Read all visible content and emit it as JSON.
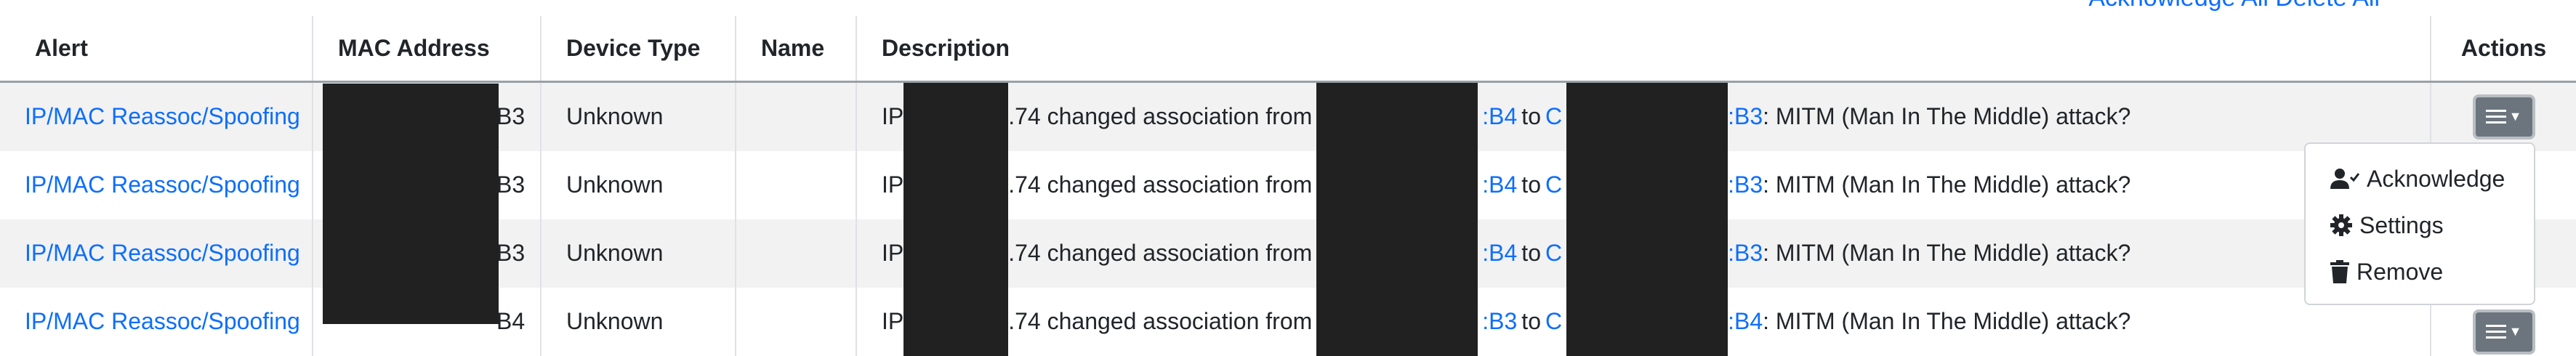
{
  "top_link": "Acknowledge All   Delete All",
  "table": {
    "headers": {
      "alert": "Alert",
      "mac": "MAC Address",
      "device_type": "Device Type",
      "name": "Name",
      "description": "Description",
      "actions": "Actions"
    },
    "rows": [
      {
        "alert": "IP/MAC Reassoc/Spoofing",
        "mac_suffix": "B3",
        "device_type": "Unknown",
        "name": "",
        "desc_ip_prefix": "IP",
        "desc_ip_suffix": ".74 changed association from",
        "desc_from_suffix": ":B4",
        "desc_to": "to",
        "desc_to_prefix": "C",
        "desc_to_suffix": ":B3",
        "desc_tail": ": MITM (Man In The Middle) attack?"
      },
      {
        "alert": "IP/MAC Reassoc/Spoofing",
        "mac_suffix": "B3",
        "device_type": "Unknown",
        "name": "",
        "desc_ip_prefix": "IP",
        "desc_ip_suffix": ".74 changed association from",
        "desc_from_suffix": ":B4",
        "desc_to": "to",
        "desc_to_prefix": "C",
        "desc_to_suffix": ":B3",
        "desc_tail": ": MITM (Man In The Middle) attack?"
      },
      {
        "alert": "IP/MAC Reassoc/Spoofing",
        "mac_suffix": "B3",
        "device_type": "Unknown",
        "name": "",
        "desc_ip_prefix": "IP",
        "desc_ip_suffix": ".74 changed association from",
        "desc_from_suffix": ":B4",
        "desc_to": "to",
        "desc_to_prefix": "C",
        "desc_to_suffix": ":B3",
        "desc_tail": ": MITM (Man In The Middle) attack?"
      },
      {
        "alert": "IP/MAC Reassoc/Spoofing",
        "mac_suffix": "B4",
        "device_type": "Unknown",
        "name": "",
        "desc_ip_prefix": "IP",
        "desc_ip_suffix": ".74 changed association from",
        "desc_from_suffix": ":B3",
        "desc_to": "to",
        "desc_to_prefix": "C",
        "desc_to_suffix": ":B4",
        "desc_tail": ": MITM (Man In The Middle) attack?"
      }
    ]
  },
  "dropdown": {
    "items": [
      {
        "label": "Acknowledge",
        "icon": "user-check-icon"
      },
      {
        "label": "Settings",
        "icon": "gear-icon"
      },
      {
        "label": "Remove",
        "icon": "trash-icon"
      }
    ]
  },
  "colors": {
    "link": "#0d6efd",
    "button": "#6c757d",
    "redaction": "#212121",
    "row_stripe": "#f2f2f2"
  }
}
